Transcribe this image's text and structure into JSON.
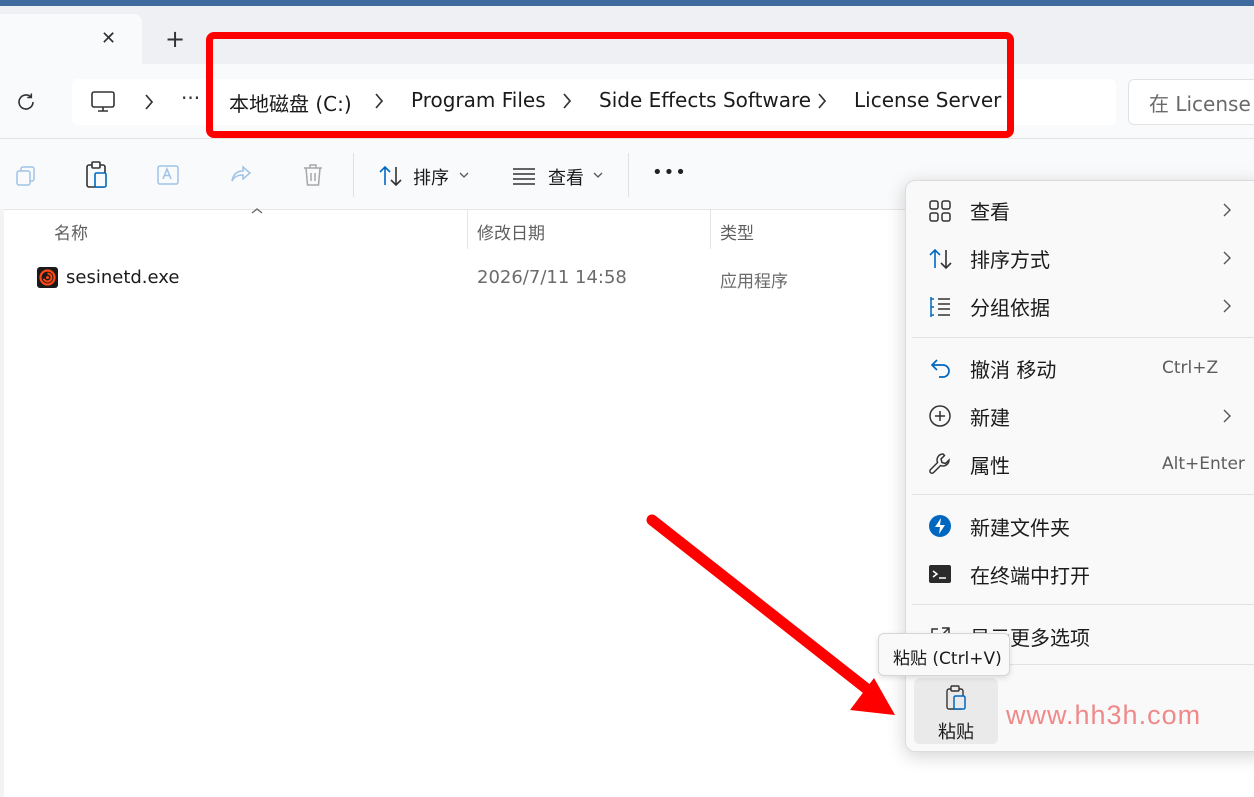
{
  "tab": {
    "close_glyph": "✕",
    "new_glyph": "+"
  },
  "breadcrumb": {
    "ellipsis": "···",
    "items": [
      "本地磁盘 (C:)",
      "Program Files",
      "Side Effects Software",
      "License Server"
    ]
  },
  "search": {
    "placeholder": "在 License Server 中搜索",
    "value": "在 License S"
  },
  "toolbar": {
    "sort_label": "排序",
    "view_label": "查看",
    "more_glyph": "•••"
  },
  "columns": {
    "name": "名称",
    "modified": "修改日期",
    "type": "类型"
  },
  "files": [
    {
      "name": "sesinetd.exe",
      "modified": "2026/7/11 14:58",
      "type": "应用程序",
      "icon": "houdini-app-icon"
    }
  ],
  "context_menu": {
    "view": "查看",
    "sort_by": "排序方式",
    "group_by": "分组依据",
    "undo_move": "撤消 移动",
    "undo_shortcut": "Ctrl+Z",
    "new": "新建",
    "properties": "属性",
    "properties_shortcut": "Alt+Enter",
    "new_folder": "新建文件夹",
    "open_in_terminal": "在终端中打开",
    "show_more_options": "显示更多选项",
    "paste_label": "粘贴"
  },
  "tooltip": {
    "text": "粘贴 (Ctrl+V)"
  },
  "watermark": {
    "text": "www.hh3h.com"
  },
  "colors": {
    "annotation_red": "#ff0000",
    "accent_blue": "#0067c0",
    "houdini_orange": "#ff4713"
  }
}
